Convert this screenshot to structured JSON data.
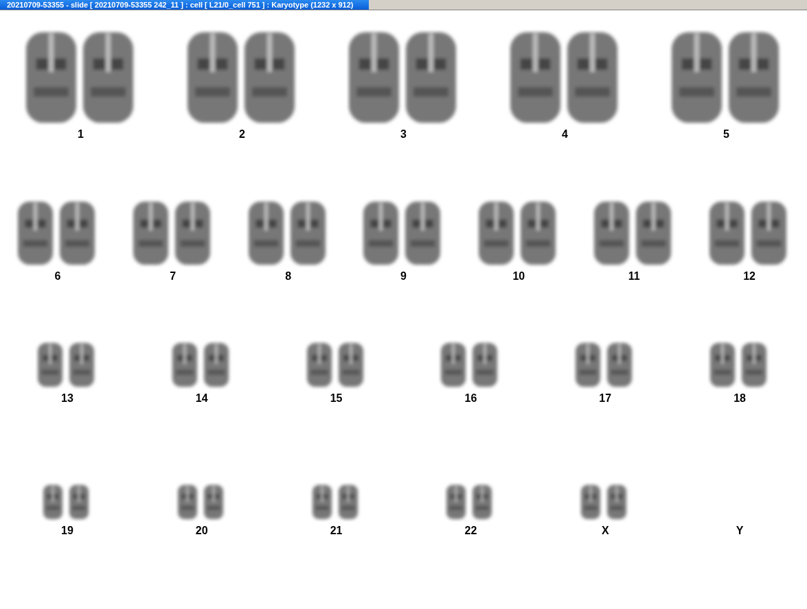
{
  "window": {
    "title": "20210709-53355 - slide [ 20210709-53355 242_11 ] : cell [ L21/0_cell 751 ] : Karyotype  (1232 x 912)"
  },
  "karyotype": {
    "rows": [
      {
        "items": [
          {
            "label": "1",
            "kind": "pair"
          },
          {
            "label": "2",
            "kind": "pair"
          },
          {
            "label": "3",
            "kind": "pair"
          },
          {
            "label": "4",
            "kind": "pair"
          },
          {
            "label": "5",
            "kind": "pair"
          }
        ]
      },
      {
        "items": [
          {
            "label": "6",
            "kind": "pair"
          },
          {
            "label": "7",
            "kind": "pair"
          },
          {
            "label": "8",
            "kind": "pair"
          },
          {
            "label": "9",
            "kind": "pair"
          },
          {
            "label": "10",
            "kind": "pair"
          },
          {
            "label": "11",
            "kind": "pair"
          },
          {
            "label": "12",
            "kind": "pair"
          }
        ]
      },
      {
        "items": [
          {
            "label": "13",
            "kind": "pair"
          },
          {
            "label": "14",
            "kind": "pair"
          },
          {
            "label": "15",
            "kind": "pair"
          },
          {
            "label": "16",
            "kind": "pair"
          },
          {
            "label": "17",
            "kind": "pair"
          },
          {
            "label": "18",
            "kind": "pair"
          }
        ]
      },
      {
        "items": [
          {
            "label": "19",
            "kind": "pair"
          },
          {
            "label": "20",
            "kind": "pair"
          },
          {
            "label": "21",
            "kind": "pair"
          },
          {
            "label": "22",
            "kind": "pair"
          },
          {
            "label": "X",
            "kind": "pair"
          },
          {
            "label": "Y",
            "kind": "empty"
          }
        ]
      }
    ]
  }
}
